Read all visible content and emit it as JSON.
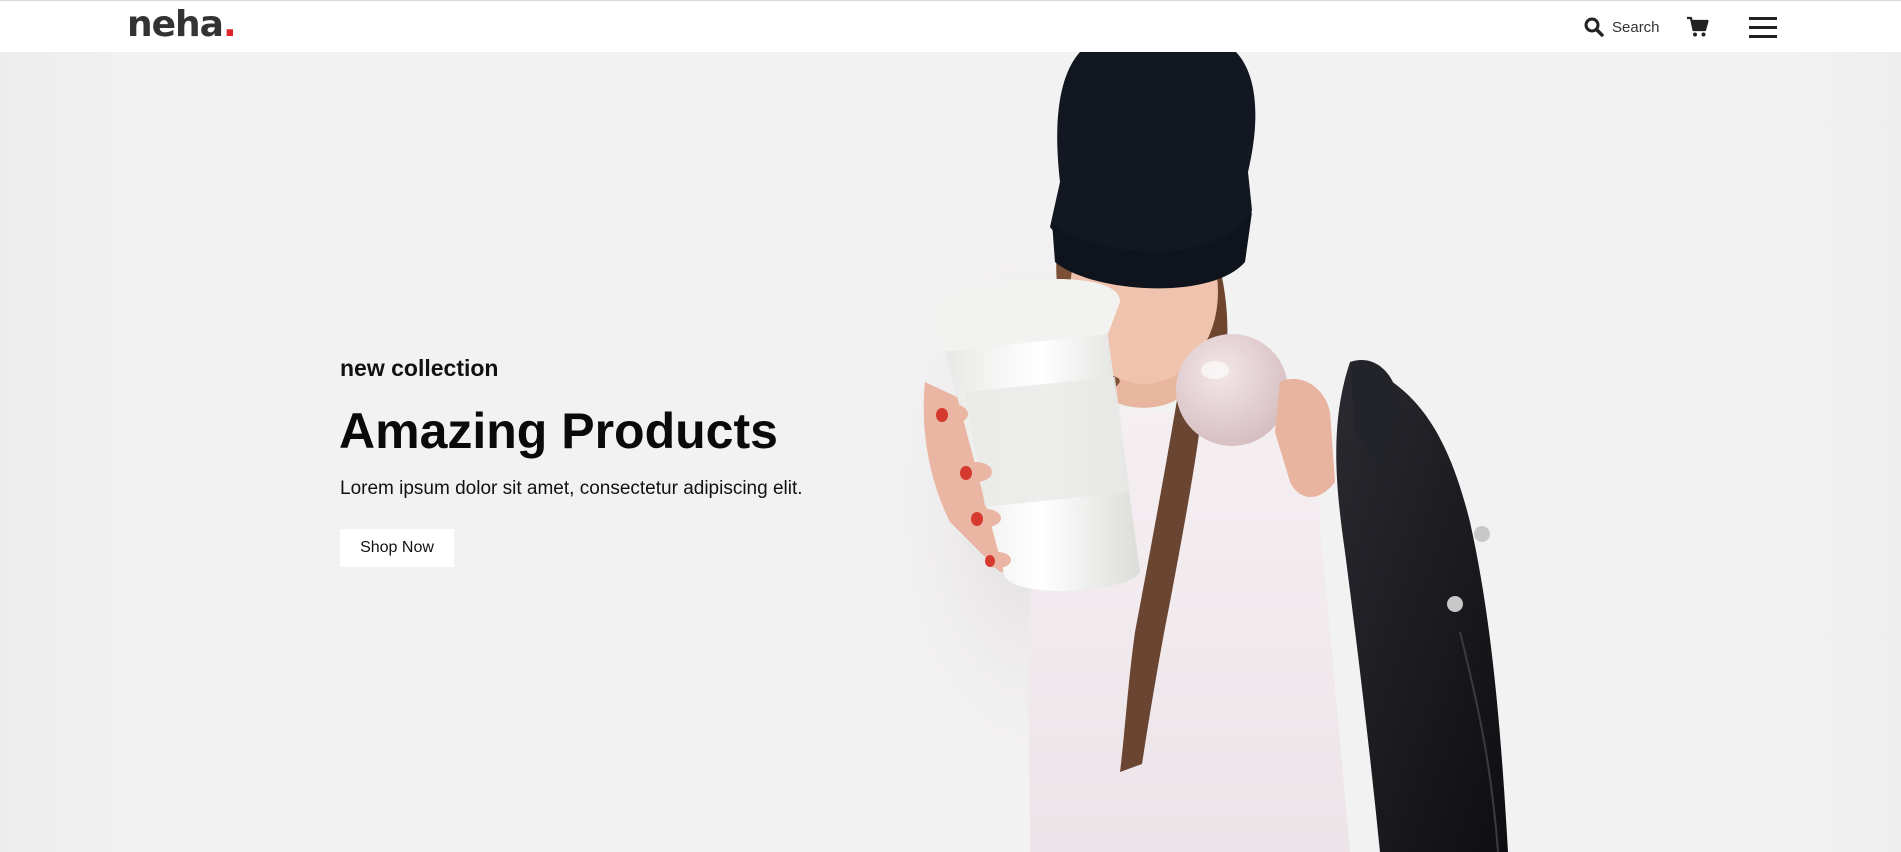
{
  "header": {
    "logo_text": "neha",
    "logo_dot": ".",
    "search_label": "Search",
    "icons": {
      "search": "search-icon",
      "cart": "cart-icon",
      "menu": "hamburger-menu-icon"
    }
  },
  "hero": {
    "tagline": "new collection",
    "headline": "Amazing Products",
    "subtext": "Lorem ipsum dolor sit amet, consectetur adipiscing elit.",
    "cta_label": "Shop Now",
    "image": "hero-model-image"
  },
  "colors": {
    "brand_dot": "#e0242e",
    "logo": "#333333",
    "hero_bg": "#f3f2f3",
    "text": "#111111"
  }
}
